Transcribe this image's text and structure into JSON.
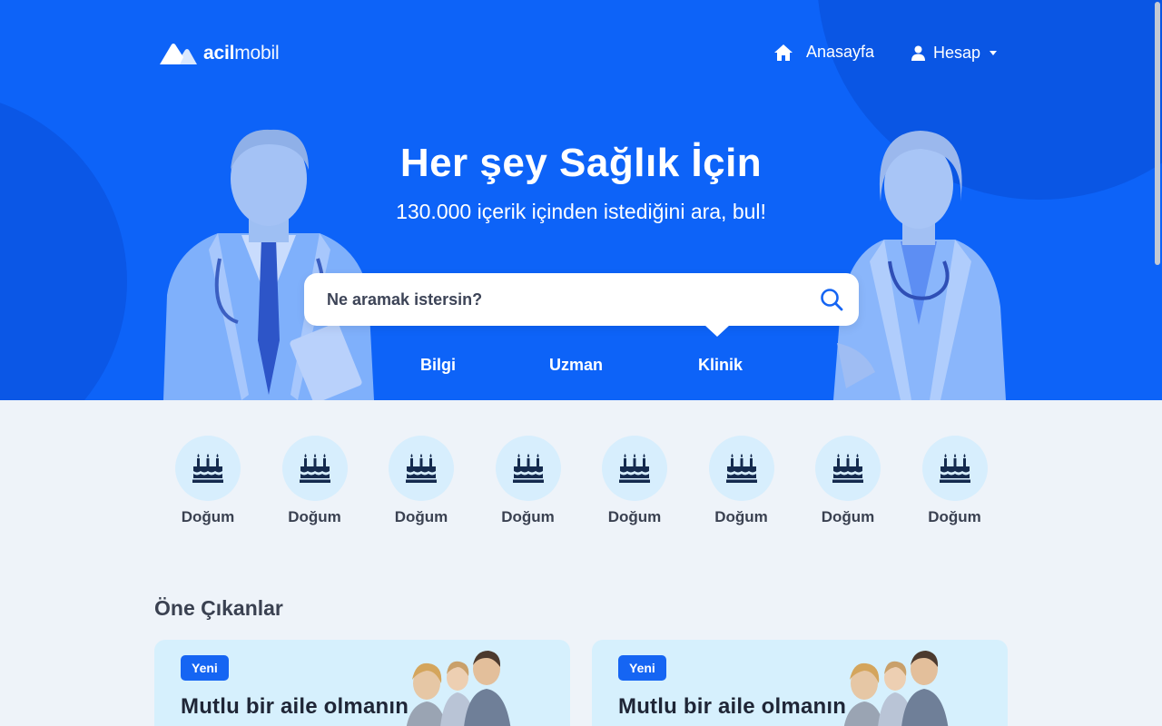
{
  "brand": {
    "name_bold": "acil",
    "name_light": "mobil"
  },
  "nav": {
    "home_label": "Anasayfa",
    "account_label": "Hesap"
  },
  "hero": {
    "title": "Her şey Sağlık İçin",
    "subtitle": "130.000 içerik içinden istediğini ara, bul!",
    "search_placeholder": "Ne aramak istersin?",
    "tabs": [
      {
        "label": "Bilgi",
        "active": false
      },
      {
        "label": "Uzman",
        "active": false
      },
      {
        "label": "Klinik",
        "active": true
      }
    ]
  },
  "categories": [
    {
      "label": "Doğum",
      "icon": "birthday-cake-icon"
    },
    {
      "label": "Doğum",
      "icon": "birthday-cake-icon"
    },
    {
      "label": "Doğum",
      "icon": "birthday-cake-icon"
    },
    {
      "label": "Doğum",
      "icon": "birthday-cake-icon"
    },
    {
      "label": "Doğum",
      "icon": "birthday-cake-icon"
    },
    {
      "label": "Doğum",
      "icon": "birthday-cake-icon"
    },
    {
      "label": "Doğum",
      "icon": "birthday-cake-icon"
    },
    {
      "label": "Doğum",
      "icon": "birthday-cake-icon"
    }
  ],
  "featured": {
    "title": "Öne Çıkanlar",
    "cards": [
      {
        "badge": "Yeni",
        "title": "Mutlu bir aile olmanın"
      },
      {
        "badge": "Yeni",
        "title": "Mutlu bir aile olmanın"
      }
    ]
  },
  "colors": {
    "hero_blue": "#0d63f8",
    "accent_blue": "#1565f3",
    "page_bg": "#eef3f9",
    "category_circle": "#d7eefd",
    "card_bg": "#d6f0fd"
  }
}
